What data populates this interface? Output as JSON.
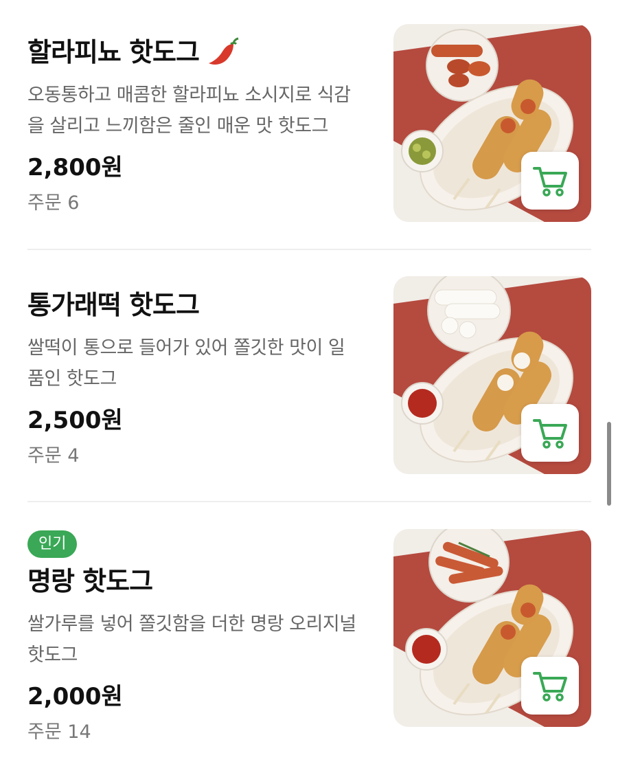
{
  "menu_items": [
    {
      "badge": "",
      "name": "할라피뇨 핫도그",
      "has_chili_icon": true,
      "description": "오동통하고 매콤한 할라피뇨 소시지로 식감을 살리고 느끼함은 줄인 매운 맛 핫도그",
      "price": "2,800원",
      "orders": "주문 6",
      "side_dish": "jalapeno",
      "plate_food": "sausage"
    },
    {
      "badge": "",
      "name": "통가래떡 핫도그",
      "has_chili_icon": false,
      "description": "쌀떡이 통으로 들어가 있어 쫄깃한 맛이 일품인 핫도그",
      "price": "2,500원",
      "orders": "주문 4",
      "side_dish": "ketchup",
      "plate_food": "ricecake"
    },
    {
      "badge": "인기",
      "name": "명랑 핫도그",
      "has_chili_icon": false,
      "description": "쌀가루를 넣어 쫄깃함을 더한 명랑 오리지널 핫도그",
      "price": "2,000원",
      "orders": "주문 14",
      "side_dish": "ketchup",
      "plate_food": "sausage-cut"
    }
  ],
  "icons": {
    "cart": "shopping-cart-icon",
    "chili": "chili-pepper-icon"
  },
  "colors": {
    "badge_green": "#3aa856",
    "cart_green": "#3aa856",
    "backdrop_red": "#b54a3f"
  }
}
